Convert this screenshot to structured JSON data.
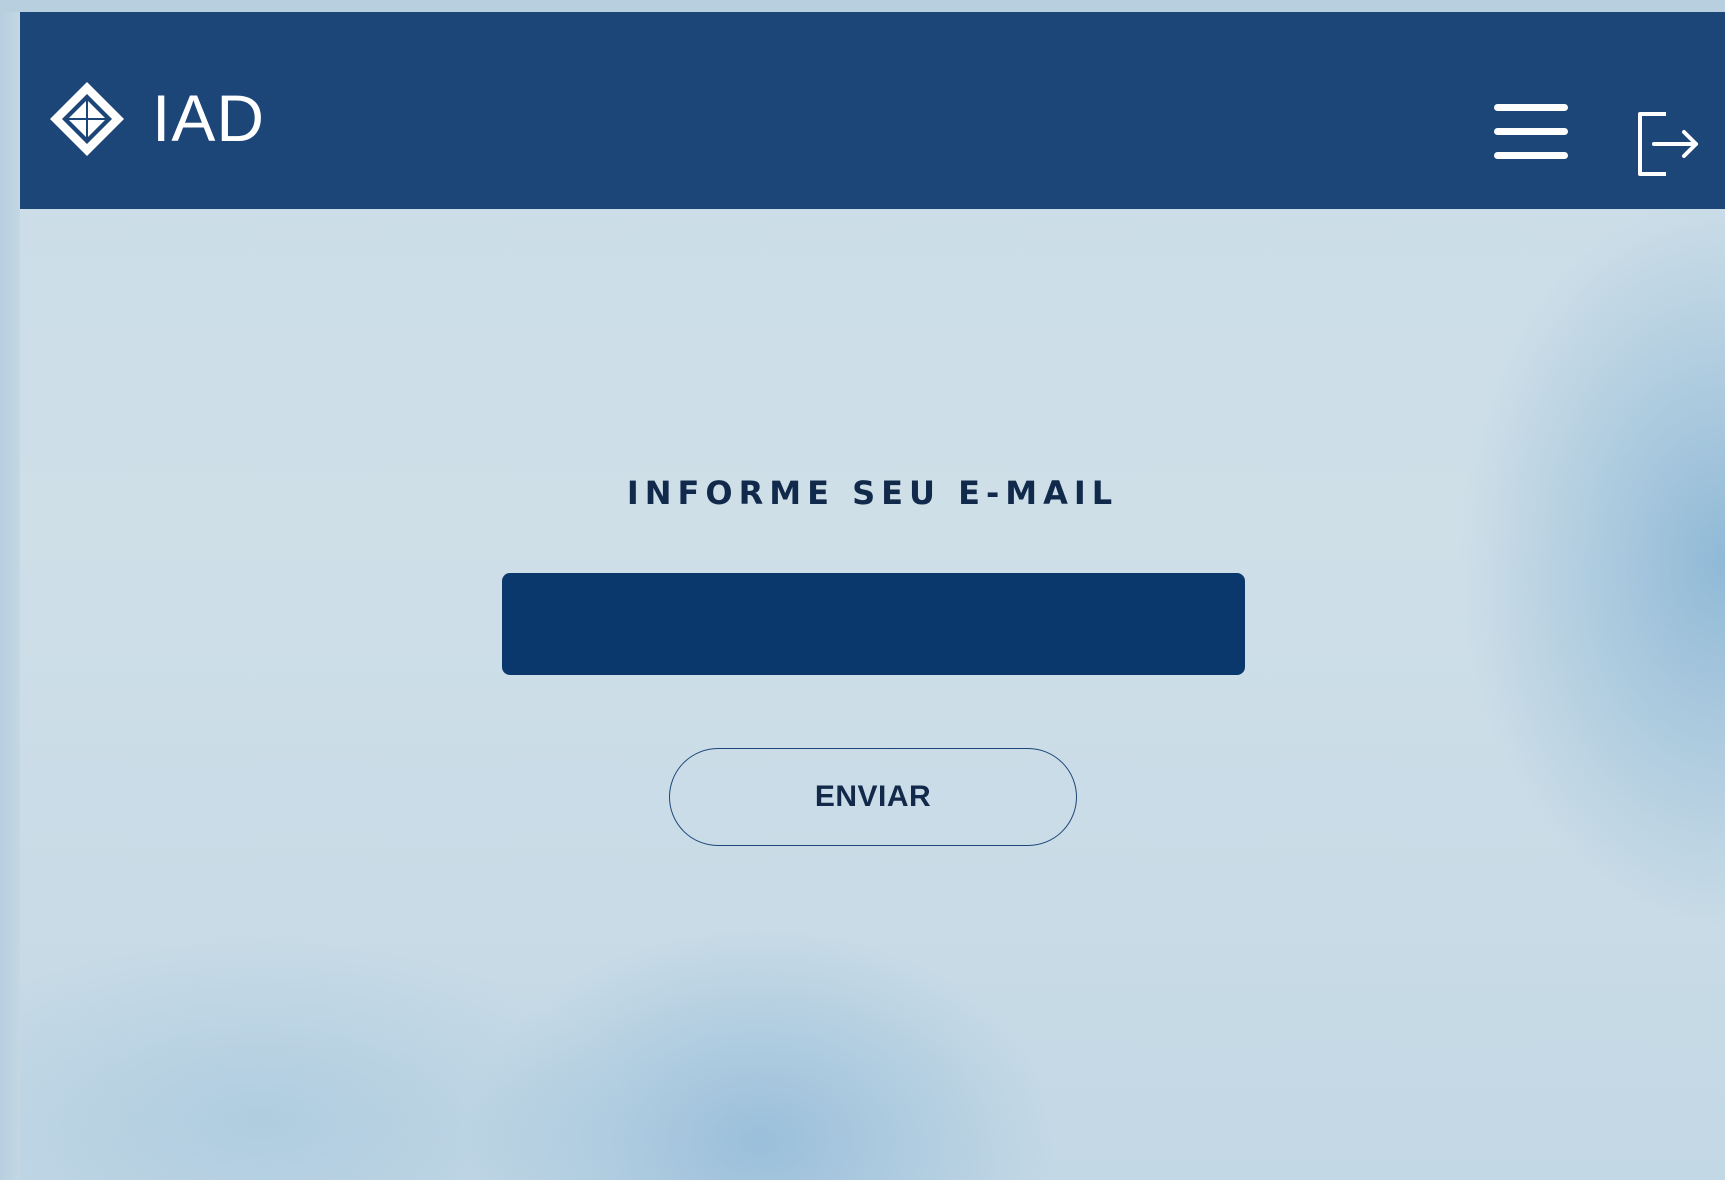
{
  "header": {
    "brand": "IAD",
    "background_color": "#1c4677",
    "logo_icon": "diamond-logo-icon",
    "menu_icon": "hamburger-menu-icon",
    "logout_icon": "logout-icon"
  },
  "form": {
    "title": "INFORME SEU E-MAIL",
    "email_value": "",
    "input_color": "#0b386c",
    "submit_label": "ENVIAR"
  }
}
